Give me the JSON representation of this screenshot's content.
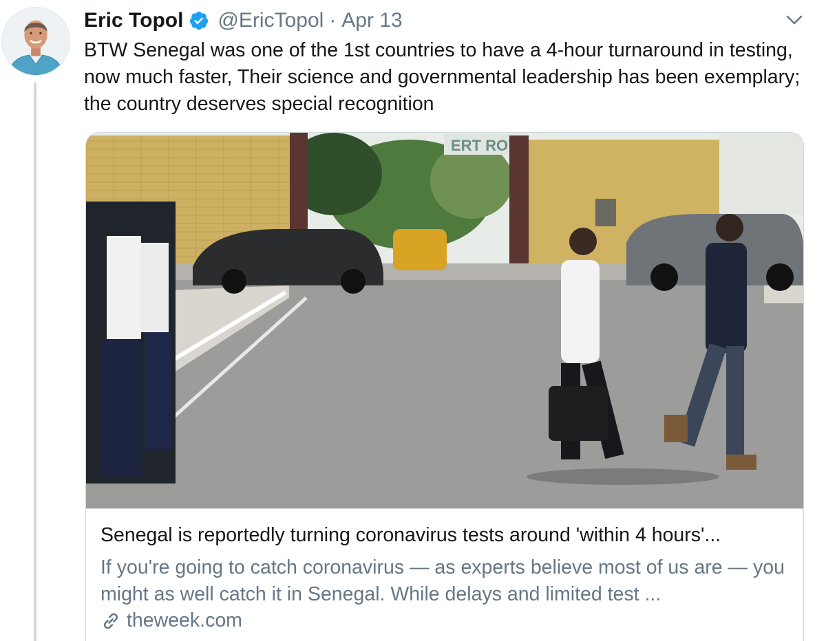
{
  "tweet": {
    "author": {
      "name": "Eric Topol",
      "handle": "@EricTopol",
      "verified": true,
      "avatar_icon": "profile-photo"
    },
    "separator": "·",
    "date": "Apr 13",
    "text": "BTW Senegal was one of the 1st countries to have a 4-hour turnaround in testing, now much faster, Their science and governmental leadership has been exemplary; the country deserves special recognition",
    "menu_icon": "chevron-down-icon",
    "card": {
      "image_alt_sign_text": "ERT ROY",
      "title": "Senegal is reportedly turning coronavirus tests around 'within 4 hours'...",
      "description": "If you're going to catch coronavirus — as experts believe most of us are — you might as well catch it in Senegal. While delays and limited test ...",
      "domain": "theweek.com",
      "link_icon": "link-icon"
    }
  },
  "colors": {
    "text": "#14171a",
    "secondary": "#657786",
    "verified": "#1da1f2",
    "border": "#cfd9de"
  }
}
